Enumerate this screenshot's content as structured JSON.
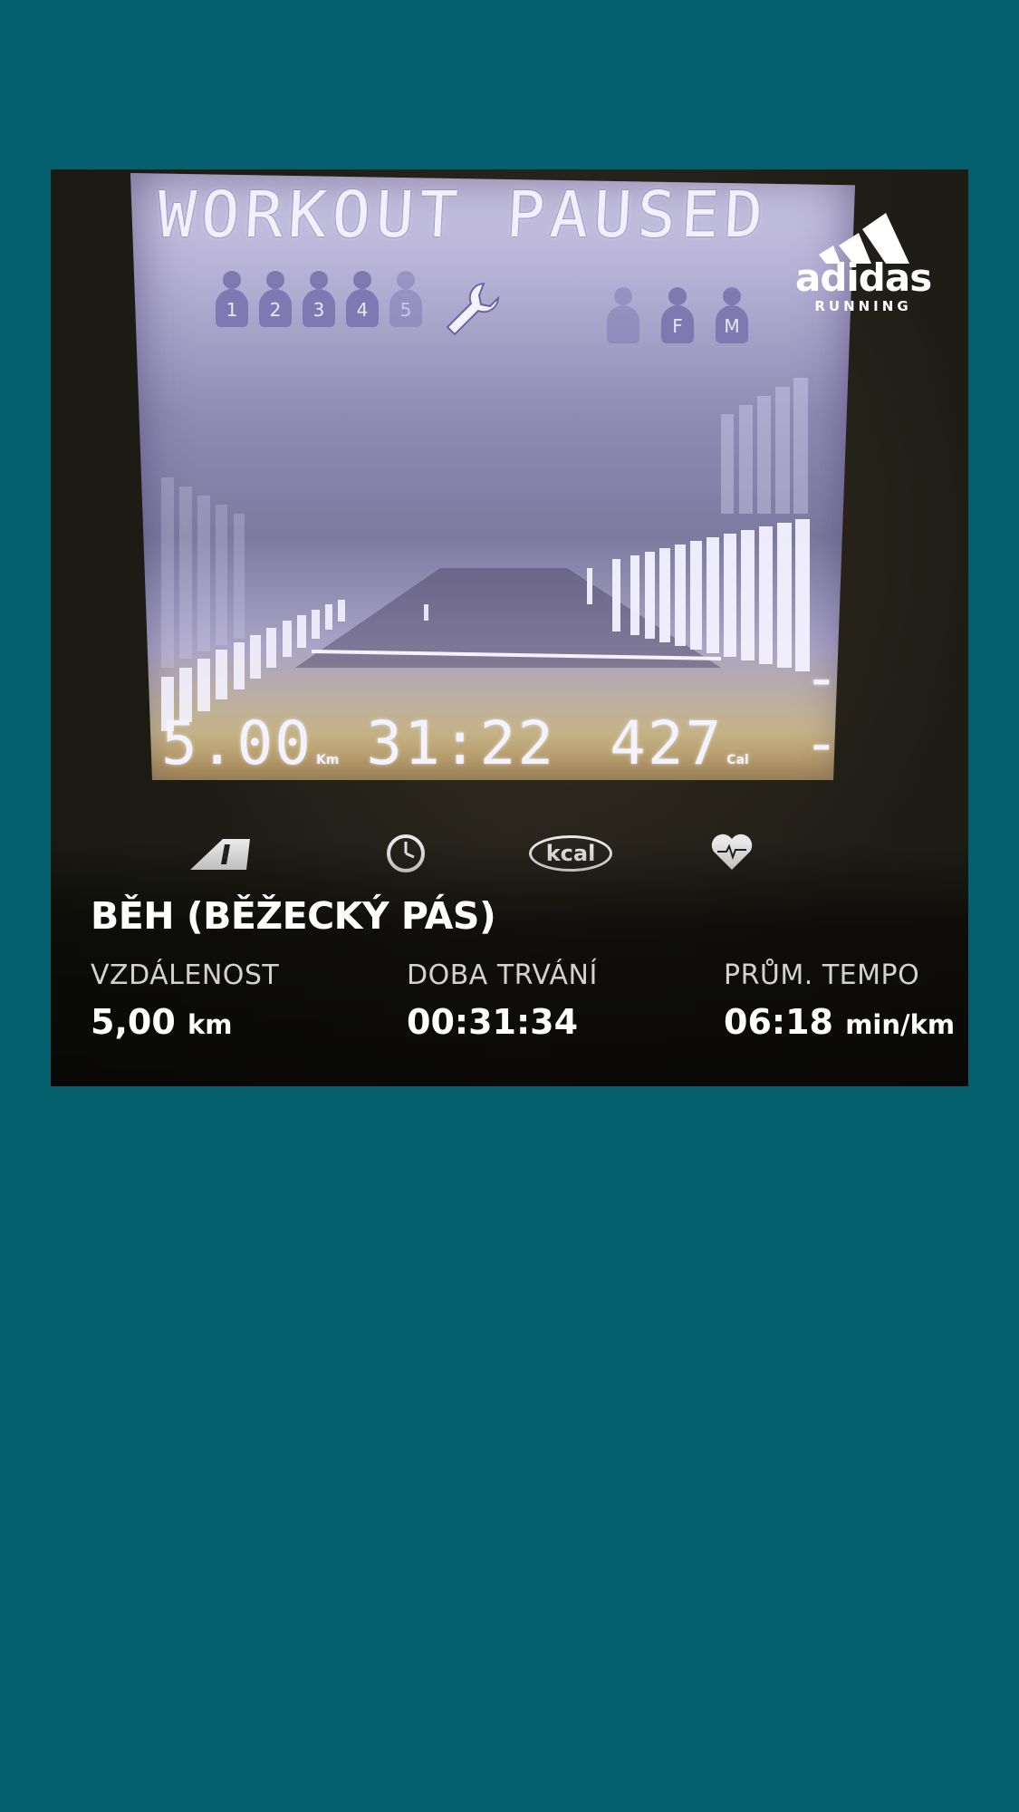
{
  "lcd": {
    "banner": "WORKOUT PAUSED",
    "profiles_left": [
      "1",
      "2",
      "3",
      "4",
      "5"
    ],
    "profiles_right": [
      "F",
      "M"
    ],
    "distance": "5.00",
    "distance_unit": "Km",
    "time": "31:22",
    "calories": "427",
    "calories_unit": "Cal",
    "heart_rate": "--"
  },
  "console_icons": [
    "road-icon",
    "clock-icon",
    "kcal-icon",
    "heart-rate-icon"
  ],
  "console_kcal_label": "kcal",
  "logo": {
    "brand": "adidas",
    "sub": "RUNNING"
  },
  "activity": {
    "title": "BĚH (BĚŽECKÝ PÁS)"
  },
  "stats": {
    "distance": {
      "label": "VZDÁLENOST",
      "value": "5,00",
      "unit": "km"
    },
    "duration": {
      "label": "DOBA TRVÁNÍ",
      "value": "00:31:34"
    },
    "pace": {
      "label": "PRŮM. TEMPO",
      "value": "06:18",
      "unit": "min/km"
    }
  },
  "colors": {
    "background": "#03606c",
    "text": "#ffffff",
    "label": "#d2d2d2"
  }
}
